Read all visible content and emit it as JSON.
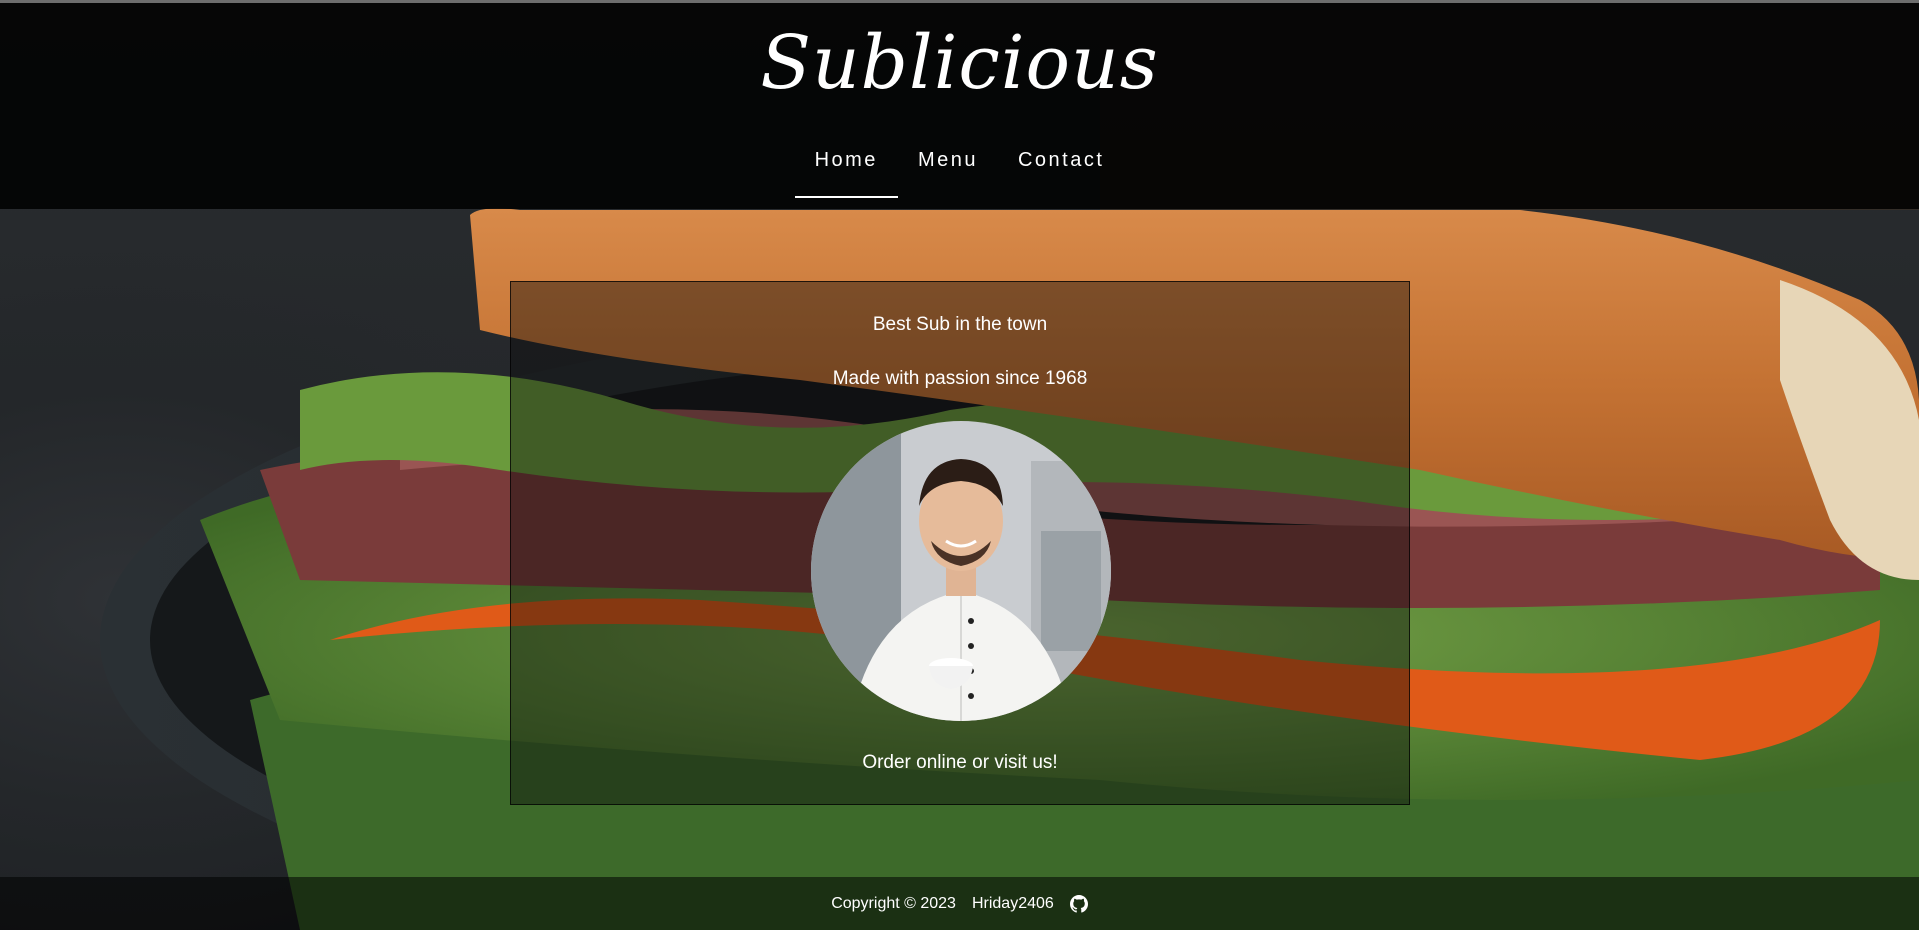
{
  "brand": {
    "title": "Sublicious"
  },
  "nav": {
    "items": [
      {
        "label": "Home",
        "active": true
      },
      {
        "label": "Menu",
        "active": false
      },
      {
        "label": "Contact",
        "active": false
      }
    ]
  },
  "hero": {
    "tagline_1": "Best Sub in the town",
    "tagline_2": "Made with passion since 1968",
    "image": "chef-portrait",
    "tagline_3": "Order online or visit us!"
  },
  "footer": {
    "copyright": "Copyright © 2023",
    "author": "Hriday2406",
    "icon": "github-icon"
  },
  "colors": {
    "header_bg": "#000000",
    "text": "#ffffff",
    "bread": "#c97a3a",
    "tomato": "#e0601a",
    "lettuce": "#5d8a3a"
  }
}
